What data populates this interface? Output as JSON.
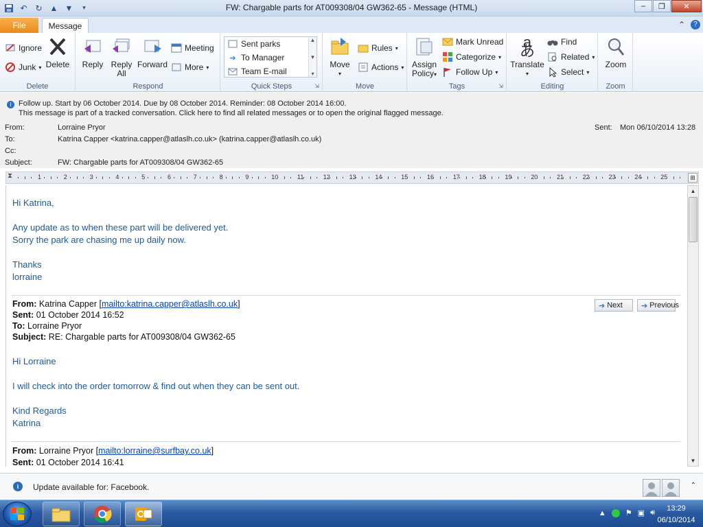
{
  "window": {
    "title": "FW: Chargable parts for AT009308/04  GW362-65  -  Message (HTML)"
  },
  "quick_access": [
    "save-icon",
    "undo-icon",
    "redo-icon",
    "up-arrow-icon",
    "down-arrow-icon",
    "customize-icon"
  ],
  "tabs": {
    "file": "File",
    "message": "Message"
  },
  "ribbon": {
    "delete_group": {
      "label": "Delete",
      "ignore": "Ignore",
      "junk": "Junk",
      "delete": "Delete"
    },
    "respond_group": {
      "label": "Respond",
      "reply": "Reply",
      "reply_all_1": "Reply",
      "reply_all_2": "All",
      "forward": "Forward",
      "meeting": "Meeting",
      "more": "More"
    },
    "quick_steps": {
      "label": "Quick Steps",
      "items": [
        "Sent parks",
        "To Manager",
        "Team E-mail"
      ]
    },
    "move_group": {
      "label": "Move",
      "move": "Move",
      "rules": "Rules",
      "actions": "Actions"
    },
    "tags_group": {
      "label": "Tags",
      "assign_1": "Assign",
      "assign_2": "Policy",
      "mark_unread": "Mark Unread",
      "categorize": "Categorize",
      "follow_up": "Follow Up"
    },
    "editing_group": {
      "label": "Editing",
      "translate": "Translate",
      "find": "Find",
      "related": "Related",
      "select": "Select"
    },
    "zoom_group": {
      "label": "Zoom",
      "zoom": "Zoom"
    }
  },
  "info": {
    "line1": "Follow up.  Start by 06 October 2014.  Due by 08 October 2014.  Reminder: 08 October 2014 16:00.",
    "line2": "This message is part of a tracked conversation. Click here to find all related messages or to open the original flagged message."
  },
  "header": {
    "from_label": "From:",
    "from_value": "Lorraine Pryor",
    "to_label": "To:",
    "to_value": "Katrina Capper <katrina.capper@atlaslh.co.uk> (katrina.capper@atlaslh.co.uk)",
    "cc_label": "Cc:",
    "cc_value": "",
    "subject_label": "Subject:",
    "subject_value": "FW: Chargable parts for AT009308/04  GW362-65",
    "sent_label": "Sent:",
    "sent_value": "Mon 06/10/2014 13:28"
  },
  "ruler": {
    "numbers": [
      "1",
      "2",
      "3",
      "4",
      "5",
      "6",
      "7",
      "8",
      "9",
      "10",
      "11",
      "12",
      "13",
      "14",
      "15",
      "16",
      "17",
      "18",
      "19",
      "20",
      "21",
      "22",
      "23",
      "24",
      "25"
    ]
  },
  "message": {
    "greeting": "Hi Katrina,",
    "line1": "Any update as to when these part will be delivered yet.",
    "line2": "Sorry the park are chasing me up  daily now.",
    "thanks": "Thanks",
    "sign": "lorraine"
  },
  "quoted1": {
    "from_label": "From:",
    "from_name": "Katrina Capper [",
    "from_link": "mailto:katrina.capper@atlaslh.co.uk",
    "from_close": "]",
    "sent_label": "Sent:",
    "sent_value": "01 October 2014 16:52",
    "to_label": "To:",
    "to_value": "Lorraine Pryor",
    "subject_label": "Subject:",
    "subject_value": "RE: Chargable parts for AT009308/04 GW362-65",
    "greeting": "Hi Lorraine",
    "body": "I will check into the order tomorrow & find out when they can be sent out.",
    "regards": "Kind Regards",
    "sign": "Katrina"
  },
  "quoted2": {
    "from_label": "From:",
    "from_name": "Lorraine Pryor [",
    "from_link": "mailto:lorraine@surfbay.co.uk",
    "from_close": "]",
    "sent_label": "Sent:",
    "sent_value": "01 October 2014 16:41"
  },
  "nav": {
    "next": "Next",
    "previous": "Previous"
  },
  "statusbar": {
    "text": "Update available for: Facebook."
  },
  "taskbar": {
    "time": "13:29",
    "date": "06/10/2014"
  }
}
